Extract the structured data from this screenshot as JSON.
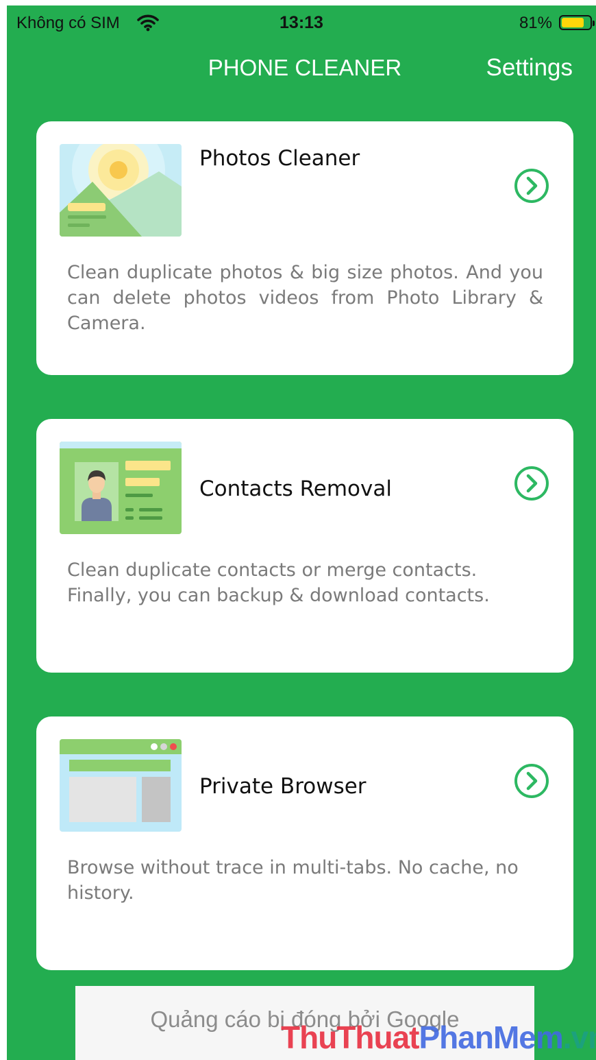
{
  "status_bar": {
    "carrier": "Không có SIM",
    "time": "13:13",
    "battery_percent": "81%",
    "battery_level": 0.81,
    "wifi_icon": "wifi-icon"
  },
  "header": {
    "title": "PHONE CLEANER",
    "settings_label": "Settings"
  },
  "cards": [
    {
      "title": "Photos Cleaner",
      "description": "Clean duplicate photos & big size photos. And you can delete photos videos from Photo Library & Camera.",
      "icon": "landscape-photo-icon"
    },
    {
      "title": "Contacts Removal",
      "description": "Clean duplicate contacts or merge contacts. Finally, you can backup & download contacts.",
      "icon": "contact-card-icon"
    },
    {
      "title": "Private Browser",
      "description": "Browse without trace in multi-tabs. No cache, no history.",
      "icon": "browser-window-icon"
    }
  ],
  "ad": {
    "text": "Quảng cáo bị đóng bởi Google"
  },
  "watermark": {
    "part1": "ThuThuat",
    "part2": "PhanMem",
    "part3": ".vn"
  },
  "colors": {
    "background_green": "#23ad50",
    "card_background": "#ffffff",
    "arrow_green": "#2db862",
    "battery_yellow": "#ffd60a"
  }
}
